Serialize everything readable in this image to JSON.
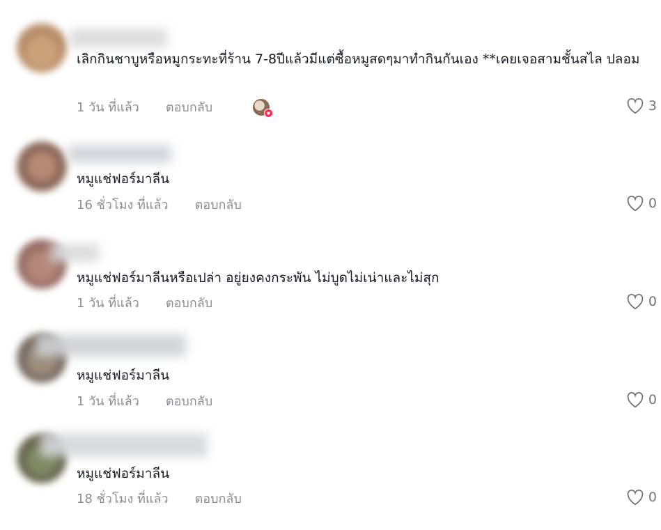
{
  "comments": [
    {
      "text": "เลิกกินชาบูหรือหมูกระทะที่ร้าน 7-8ปีแล้วมีแต่ซื้อหมูสดๆมาทำกินกันเอง **เคยเจอสามชั้นสไล ปลอม",
      "time": "1 วัน ที่แล้ว",
      "reply": "ตอบกลับ",
      "likes": "3",
      "liked_by_creator": true
    },
    {
      "text": "หมูแช่ฟอร์มาลีน",
      "time": "16 ชั่วโมง ที่แล้ว",
      "reply": "ตอบกลับ",
      "likes": "0"
    },
    {
      "text": "หมูแช่ฟอร์มาลีนหรือเปล่า อยู่ยงคงกระพัน ไม่บูดไม่เน่าและไม่สุก",
      "time": "1 วัน ที่แล้ว",
      "reply": "ตอบกลับ",
      "likes": "0"
    },
    {
      "text": "หมูแช่ฟอร์มาลีน",
      "time": "1 วัน ที่แล้ว",
      "reply": "ตอบกลับ",
      "likes": "0"
    },
    {
      "text": "หมูแช่ฟอร์มาลีน",
      "time": "18 ชั่วโมง ที่แล้ว",
      "reply": "ตอบกลับ",
      "likes": "0"
    }
  ],
  "icons": {
    "like": "heart-outline-icon",
    "creator_like": "heart-badge-icon"
  },
  "colors": {
    "text": "#161823",
    "meta": "#8a8b91",
    "badge": "#fe2c55"
  }
}
